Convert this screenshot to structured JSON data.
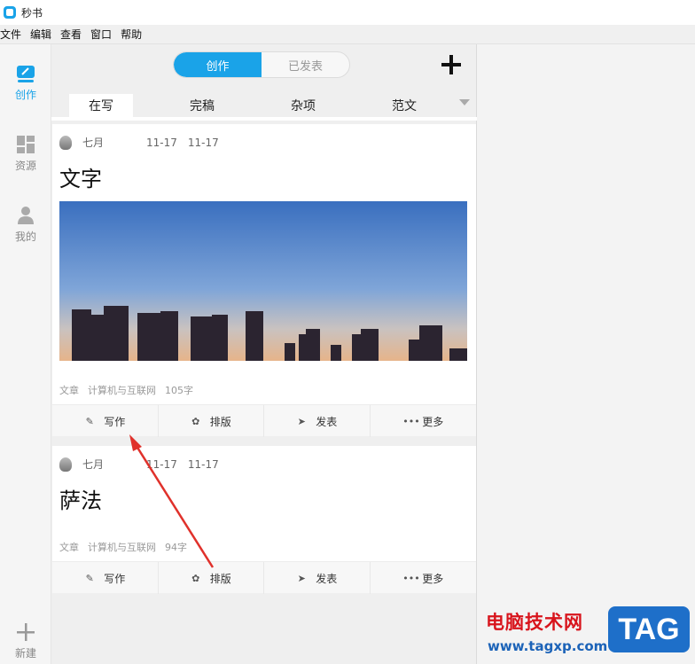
{
  "app": {
    "title": "秒书"
  },
  "menu": [
    "文件",
    "编辑",
    "查看",
    "窗口",
    "帮助"
  ],
  "sidebar": {
    "items": [
      {
        "label": "创作",
        "icon": "edit-icon",
        "active": true
      },
      {
        "label": "资源",
        "icon": "grid-icon",
        "active": false
      },
      {
        "label": "我的",
        "icon": "user-icon",
        "active": false
      }
    ],
    "new_label": "新建"
  },
  "segment": {
    "options": [
      "创作",
      "已发表"
    ],
    "selected": "创作"
  },
  "tabs": [
    "在写",
    "完稿",
    "杂项",
    "范文"
  ],
  "active_tab": "在写",
  "cards": [
    {
      "author": "七月",
      "date1": "11-17",
      "date2": "11-17",
      "title": "文字",
      "type": "文章",
      "category": "计算机与互联网",
      "word_count": "105字"
    },
    {
      "author": "七月",
      "date1": "11-17",
      "date2": "11-17",
      "title": "萨法",
      "type": "文章",
      "category": "计算机与互联网",
      "word_count": "94字"
    }
  ],
  "actions": [
    "写作",
    "排版",
    "发表",
    "更多"
  ],
  "watermark": {
    "line1": "电脑技术网",
    "line2": "www.tagxp.com",
    "tag": "TAG"
  },
  "colors": {
    "accent": "#1aa3e8",
    "arrow": "#e0312b"
  }
}
